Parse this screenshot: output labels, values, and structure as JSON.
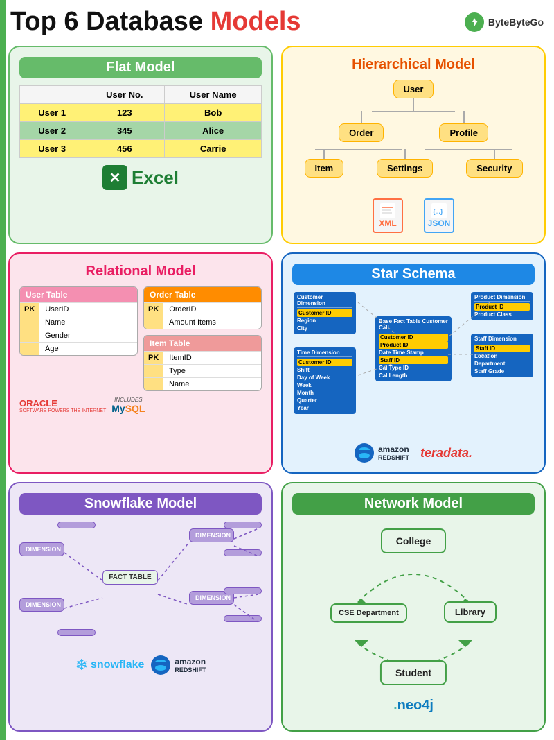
{
  "header": {
    "title_part1": "Top 6 Database",
    "title_part2": "Models",
    "brand_name": "ByteByteGo"
  },
  "flat_model": {
    "title": "Flat Model",
    "table": {
      "headers": [
        "",
        "User No.",
        "User Name"
      ],
      "rows": [
        {
          "label": "User 1",
          "number": "123",
          "name": "Bob",
          "color": "yellow"
        },
        {
          "label": "User 2",
          "number": "345",
          "name": "Alice",
          "color": "green"
        },
        {
          "label": "User 3",
          "number": "456",
          "name": "Carrie",
          "color": "yellow"
        }
      ]
    },
    "logo_text": "Excel"
  },
  "hierarchical_model": {
    "title": "Hierarchical Model",
    "nodes": {
      "root": "User",
      "level2": [
        "Order",
        "Profile"
      ],
      "level3": [
        "Item",
        "Settings",
        "Security"
      ]
    },
    "files": [
      "XML",
      "JSON"
    ]
  },
  "relational_model": {
    "title": "Relational Model",
    "user_table": {
      "header": "User Table",
      "rows": [
        "UserID",
        "Name",
        "Gender",
        "Age"
      ],
      "pk": "PK"
    },
    "order_table": {
      "header": "Order Table",
      "rows": [
        "OrderID",
        "Amount",
        "Items"
      ],
      "pk": "PK"
    },
    "item_table": {
      "header": "Item Table",
      "rows": [
        "ItemID",
        "Type",
        "Name"
      ],
      "pk": "PK"
    },
    "logos": {
      "oracle": "ORACLE",
      "oracle_sub": "SOFTWARE POWERS THE INTERNET",
      "includes": "INCLUDES",
      "mysql": "MySQL"
    }
  },
  "star_schema": {
    "title": "Star Schema",
    "dimensions": {
      "customer": {
        "title": "Customer Dimension",
        "fields": [
          "Customer ID",
          "Region",
          "City"
        ]
      },
      "time": {
        "title": "Time Dimension",
        "fields": [
          "Customer ID",
          "Shift",
          "Day of Week",
          "Week",
          "Month",
          "Quarter",
          "Year"
        ]
      },
      "product": {
        "title": "Product Dimension",
        "fields": [
          "Product ID",
          "Product Class"
        ]
      },
      "staff": {
        "title": "Staff Dimension",
        "fields": [
          "Staff ID",
          "Location",
          "Department",
          "Staff Grade"
        ]
      }
    },
    "fact": {
      "title": "Base Fact Table Customer Call",
      "fields": [
        "Customer ID",
        "Product ID",
        "Date Time Stamp",
        "Staff ID",
        "Cal Type ID",
        "Cal Length"
      ]
    },
    "logos": {
      "amazon": "amazon",
      "amazon_sub": "REDSHIFT",
      "teradata": "teradata."
    }
  },
  "snowflake_model": {
    "title": "Snowflake Model",
    "labels": {
      "dimension": "DIMENSION",
      "fact_table": "FACT TABLE"
    },
    "logos": {
      "snowflake": "snowflake",
      "amazon": "amazon",
      "amazon_sub": "REDSHIFT"
    }
  },
  "network_model": {
    "title": "Network Model",
    "nodes": [
      "College",
      "CSE Department",
      "Library",
      "Student"
    ],
    "logo": ".neo4j"
  }
}
